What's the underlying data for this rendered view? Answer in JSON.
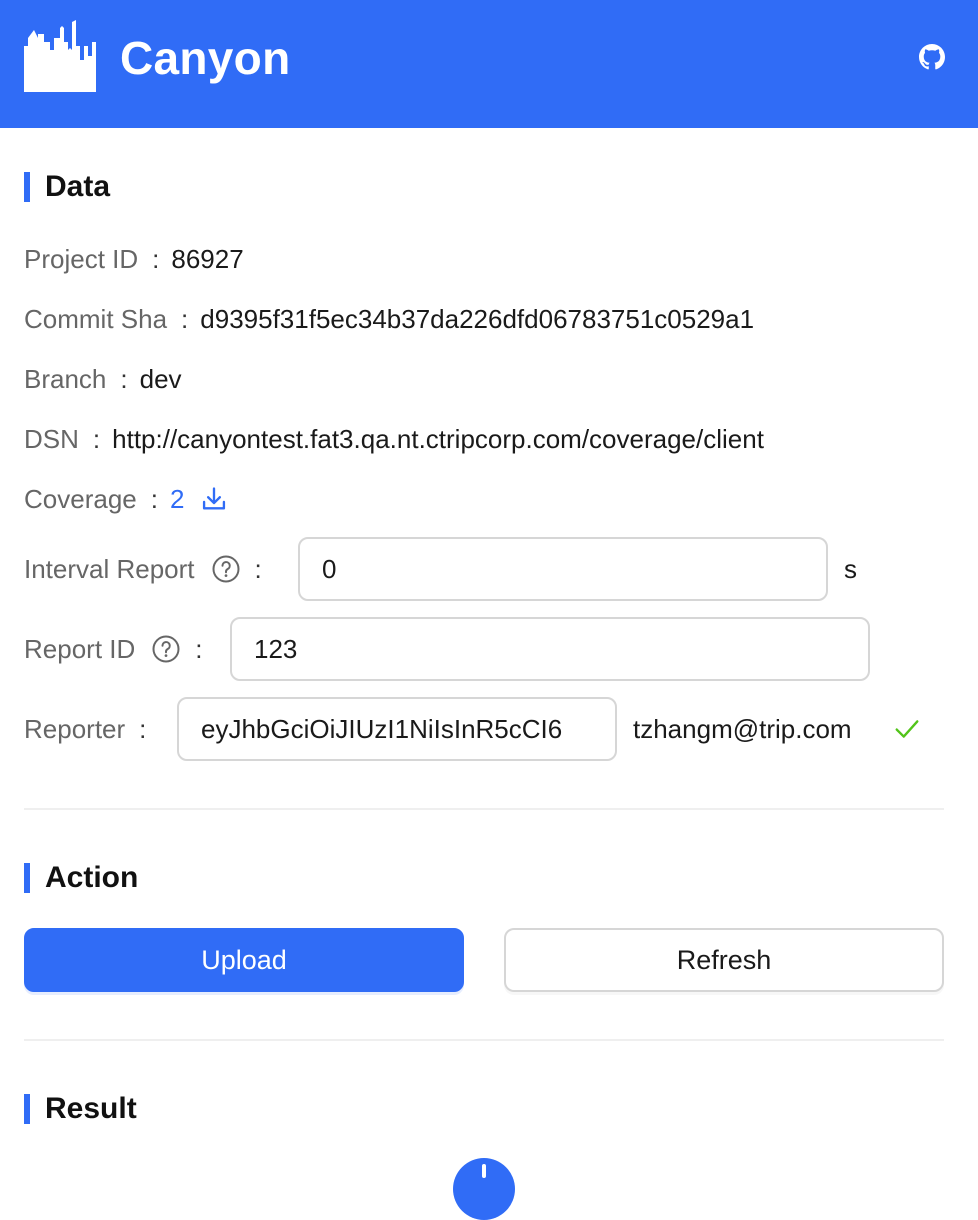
{
  "app": {
    "title": "Canyon"
  },
  "sections": {
    "data": "Data",
    "action": "Action",
    "result": "Result"
  },
  "fields": {
    "project_id": {
      "label": "Project ID",
      "value": "86927"
    },
    "commit_sha": {
      "label": "Commit Sha",
      "value": "d9395f31f5ec34b37da226dfd06783751c0529a1"
    },
    "branch": {
      "label": "Branch",
      "value": "dev"
    },
    "dsn": {
      "label": "DSN",
      "value": "http://canyontest.fat3.qa.nt.ctripcorp.com/coverage/client"
    },
    "coverage": {
      "label": "Coverage",
      "value": "2"
    },
    "interval_report": {
      "label": "Interval Report",
      "value": "0",
      "suffix": "s"
    },
    "report_id": {
      "label": "Report ID",
      "value": "123"
    },
    "reporter": {
      "label": "Reporter",
      "value": "eyJhbGciOiJIUzI1NiIsInR5cCI6",
      "user": "tzhangm@trip.com"
    }
  },
  "colon": ":",
  "buttons": {
    "upload": "Upload",
    "refresh": "Refresh"
  },
  "icons": {
    "logo": "city-skyline-icon",
    "github": "github-icon",
    "help": "question-circle-icon",
    "download": "download-icon",
    "verified": "check-icon"
  },
  "colors": {
    "brand": "#306cf6",
    "success": "#52c41a"
  }
}
